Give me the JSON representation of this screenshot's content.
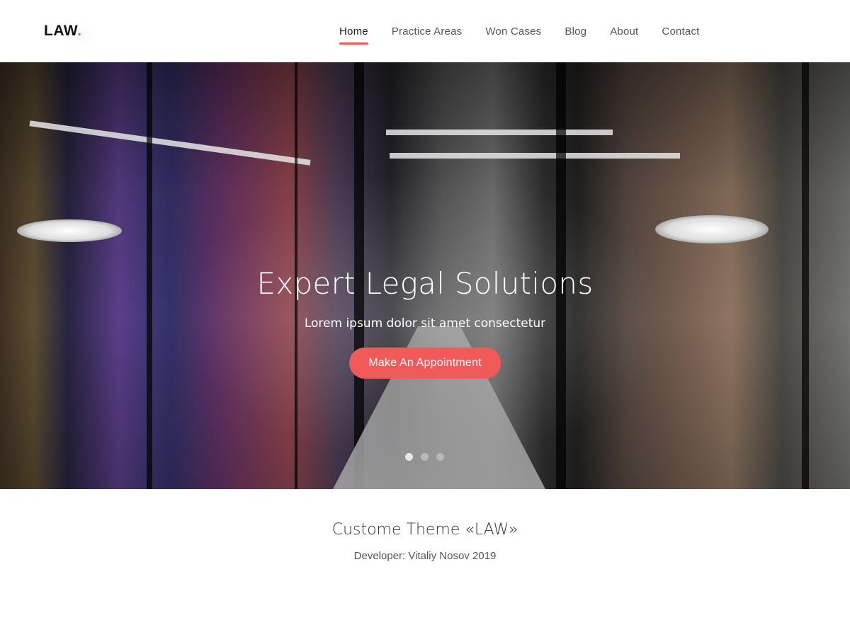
{
  "header": {
    "logo_text": "LAW",
    "logo_dot": ".",
    "nav": [
      {
        "label": "Home",
        "active": true
      },
      {
        "label": "Practice Areas",
        "active": false
      },
      {
        "label": "Won Cases",
        "active": false
      },
      {
        "label": "Blog",
        "active": false
      },
      {
        "label": "About",
        "active": false
      },
      {
        "label": "Contact",
        "active": false
      }
    ]
  },
  "hero": {
    "title": "Expert Legal Solutions",
    "subtitle": "Lorem ipsum dolor sit amet consectetur",
    "cta_label": "Make An Appointment",
    "slides": 3,
    "active_slide": 1
  },
  "footer": {
    "title": "Custome Theme «LAW»",
    "developer": "Developer: Vitaliy Nosov 2019"
  },
  "colors": {
    "accent": "#f25a5a",
    "text_dark": "#222222",
    "nav_text": "#555555"
  }
}
